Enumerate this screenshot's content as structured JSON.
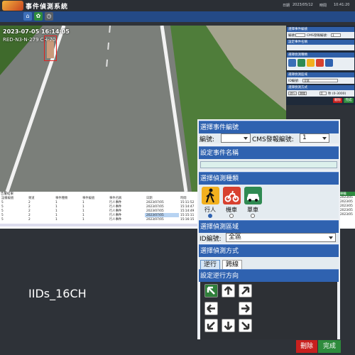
{
  "header": {
    "app_title": "事件偵測系統",
    "date_label": "日期",
    "date_value": "2023/05/12",
    "time_label": "時間",
    "time_value": "10:41:20"
  },
  "nav": {
    "buttons": [
      {
        "icon": "home-icon",
        "glyph": "⌂"
      },
      {
        "icon": "gear-icon",
        "glyph": "✿"
      },
      {
        "icon": "clock-icon",
        "glyph": "◷"
      }
    ]
  },
  "video": {
    "timestamp": "2023-07-05 16:14:05",
    "plate": "RED-N3-N-279 CH-70"
  },
  "mini_panel": {
    "event_id_header": "選擇事件編號",
    "id_label": "編號:",
    "cms_label": "CMS發報編號:",
    "cms_value": "1",
    "name_header": "設定事件名稱",
    "detect_header": "選擇偵測種類",
    "detect_labels": [
      "行人",
      "機車",
      "單車",
      "逆向",
      "車"
    ],
    "region_header": "選擇偵測區域",
    "region_label": "ID編號:",
    "region_value": "全區",
    "method_header": "選擇偵測方式",
    "method_buttons": [
      "逆行",
      "跨線"
    ],
    "range_label": "秒 (0-3000)",
    "range_value": "0",
    "delete_label": "刪除",
    "done_label": "完成"
  },
  "results": {
    "title": "告警結果",
    "columns": [
      "設備編號",
      "頻道",
      "事件種類",
      "事件編號",
      "事件名稱",
      "日期",
      "時間"
    ],
    "rows": [
      [
        "5",
        "2",
        "1",
        "1",
        "行人事件",
        "2023/07/05",
        "15:11:52"
      ],
      [
        "5",
        "2",
        "1",
        "1",
        "行人事件",
        "2023/07/05",
        "15:14:47"
      ],
      [
        "5",
        "2",
        "1",
        "1",
        "行人事件",
        "2023/07/05",
        "15:14:49"
      ],
      [
        "5",
        "2",
        "1",
        "1",
        "行人事件",
        "2023/07/05",
        "15:15:11"
      ],
      [
        "5",
        "2",
        "1",
        "1",
        "行人事件",
        "2023/07/05",
        "15:16:15"
      ]
    ],
    "selected_row": 3
  },
  "right_strip": {
    "header": "車輛",
    "rows": [
      "2023/05",
      "2023/05",
      "2023/05",
      "2023/05",
      "2023/05"
    ]
  },
  "watermark": "IIDs_16CH",
  "panel": {
    "event_id": {
      "header": "選擇事件編號",
      "id_label": "編號:",
      "id_value": "",
      "cms_label": "CMS發報編號:",
      "cms_value": "1"
    },
    "event_name": {
      "header": "設定事件名稱",
      "value": ""
    },
    "detect_type": {
      "header": "選擇偵測種類",
      "options": [
        {
          "label": "行人",
          "icon": "pedestrian-icon",
          "color": "#f2b01e",
          "selected": true
        },
        {
          "label": "機車",
          "icon": "motorcycle-icon",
          "color": "#d8412f",
          "selected": false
        },
        {
          "label": "單車",
          "icon": "car-icon",
          "color": "#2f8a52",
          "selected": false
        }
      ]
    },
    "region": {
      "header": "選擇偵測區域",
      "label": "ID編號:",
      "value": "全區"
    },
    "method": {
      "header": "選擇偵測方式",
      "buttons": [
        {
          "label": "逆行",
          "selected": true
        },
        {
          "label": "跨線",
          "selected": false
        }
      ]
    },
    "direction": {
      "header": "設定逆行方向",
      "selected": "up-left"
    }
  },
  "actions": {
    "delete": "刪除",
    "done": "完成"
  }
}
